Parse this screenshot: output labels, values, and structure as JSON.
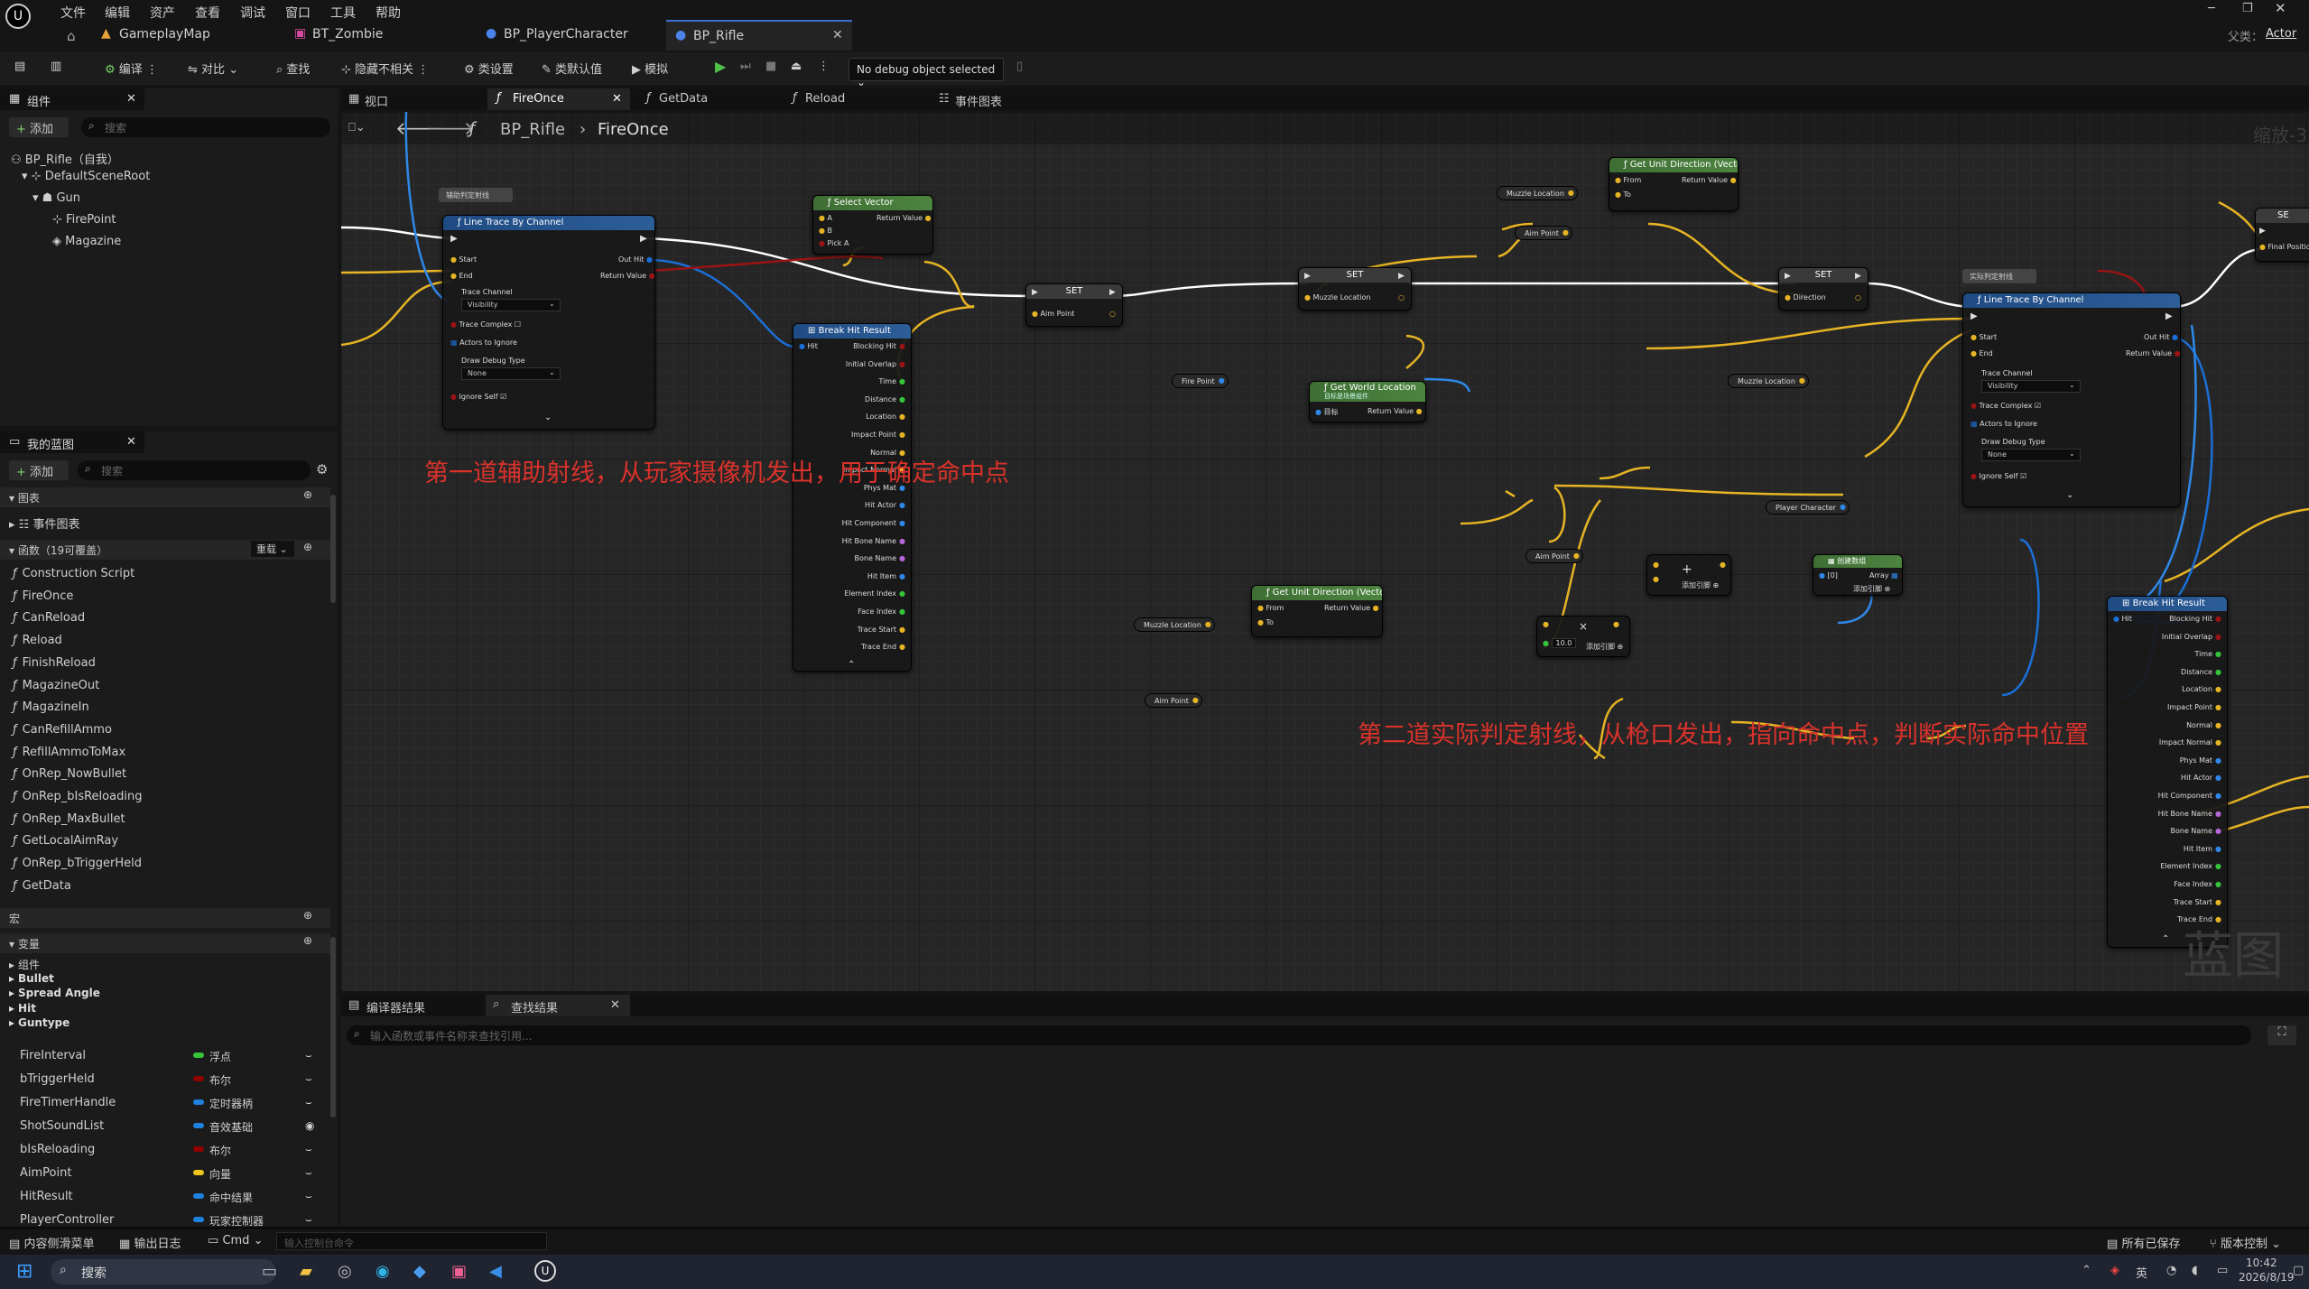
{
  "menu": [
    "文件",
    "编辑",
    "资产",
    "查看",
    "调试",
    "窗口",
    "工具",
    "帮助"
  ],
  "tabs": [
    "GameplayMap",
    "BT_Zombie",
    "BP_PlayerCharacter",
    "BP_Rifle"
  ],
  "parent_label": "父类：",
  "parent_value": "Actor",
  "toolbar": {
    "compile": "编译",
    "diff": "对比",
    "find": "查找",
    "hide_unrelated": "隐藏不相关",
    "class_settings": "类设置",
    "class_defaults": "类默认值",
    "simulate": "模拟",
    "debug_select": "No debug object selected"
  },
  "components_panel": {
    "title": "组件",
    "add": "添加",
    "search_placeholder": "搜索",
    "items": [
      "BP_Rifle（自我）",
      "DefaultSceneRoot",
      "Gun",
      "FirePoint",
      "Magazine"
    ]
  },
  "graph_tabs": [
    "视口",
    "FireOnce",
    "GetData",
    "Reload",
    "事件图表"
  ],
  "breadcrumb": {
    "root": "BP_Rifle",
    "current": "FireOnce"
  },
  "zoom": "缩放-3",
  "watermark": "蓝图",
  "my_blueprint": {
    "title": "我的蓝图",
    "add": "添加",
    "search_placeholder": "搜索",
    "graphs_header": "图表",
    "event_graph": "事件图表",
    "functions_header": "函数（19可覆盖）",
    "override_label": "重载",
    "functions": [
      "Construction Script",
      "FireOnce",
      "CanReload",
      "Reload",
      "FinishReload",
      "MagazineOut",
      "MagazineIn",
      "CanRefillAmmo",
      "RefillAmmoToMax",
      "OnRep_NowBullet",
      "OnRep_bIsReloading",
      "OnRep_MaxBullet",
      "GetLocalAimRay",
      "OnRep_bTriggerHeld",
      "GetData"
    ],
    "macros_header": "宏",
    "variables_header": "变量",
    "var_groups": [
      "组件",
      "Bullet",
      "Spread Angle",
      "Hit",
      "Guntype"
    ],
    "variables": [
      {
        "name": "FireInterval",
        "type": "浮点",
        "color": "#35c43a"
      },
      {
        "name": "bTriggerHeld",
        "type": "布尔",
        "color": "#920000"
      },
      {
        "name": "FireTimerHandle",
        "type": "定时器柄",
        "color": "#1f82e0"
      },
      {
        "name": "ShotSoundList",
        "type": "音效基础",
        "color": "#1f82e0"
      },
      {
        "name": "bIsReloading",
        "type": "布尔",
        "color": "#920000"
      },
      {
        "name": "AimPoint",
        "type": "向量",
        "color": "#f0c419"
      },
      {
        "name": "HitResult",
        "type": "命中结果",
        "color": "#1f82e0"
      },
      {
        "name": "PlayerController",
        "type": "玩家控制器",
        "color": "#1f82e0"
      }
    ]
  },
  "annotations": {
    "first": "第一道辅助射线，从玩家摄像机发出，用于确定命中点",
    "second": "第二道实际判定射线，从枪口发出，指向命中点，判断实际命中位置"
  },
  "nodes": {
    "lt1": {
      "comment": "辅助判定射线",
      "title": "Line Trace By Channel",
      "pins_l": [
        "Start",
        "End"
      ],
      "pins_r": [
        "Out Hit",
        "Return Value"
      ],
      "channel_label": "Trace Channel",
      "channel_value": "Visibility",
      "complex": "Trace Complex",
      "actors": "Actors to Ignore",
      "debug_label": "Draw Debug Type",
      "debug_value": "None",
      "ignore_self": "Ignore Self"
    },
    "select": {
      "title": "Select Vector",
      "pins_l": [
        "A",
        "B",
        "Pick A"
      ],
      "pins_r": [
        "Return Value"
      ]
    },
    "bhr1": {
      "title": "Break Hit Result",
      "pin_l": "Hit",
      "pins_r": [
        "Blocking Hit",
        "Initial Overlap",
        "Time",
        "Distance",
        "Location",
        "Impact Point",
        "Normal",
        "Impact Normal",
        "Phys Mat",
        "Hit Actor",
        "Hit Component",
        "Hit Bone Name",
        "Bone Name",
        "Hit Item",
        "Element Index",
        "Face Index",
        "Trace Start",
        "Trace End"
      ]
    },
    "set1": {
      "title": "SET",
      "pin": "Aim Point"
    },
    "set2": {
      "title": "SET",
      "pin": "Muzzle Location"
    },
    "set3": {
      "title": "SET",
      "pin": "Direction"
    },
    "gud1": {
      "title": "Get Unit Direction (Vector)",
      "pins_l": [
        "From",
        "To"
      ],
      "pins_r": [
        "Return Value"
      ]
    },
    "gwl": {
      "title": "Get World Location",
      "subtitle": "目标是场景组件",
      "pin_l": "目标",
      "pin_r": "Return Value"
    },
    "lt2": {
      "comment": "实际判定射线",
      "title": "Line Trace By Channel",
      "pins_l": [
        "Start",
        "End"
      ],
      "pins_r": [
        "Out Hit",
        "Return Value"
      ],
      "channel_label": "Trace Channel",
      "channel_value": "Visibility",
      "complex": "Trace Complex",
      "actors": "Actors to Ignore",
      "debug_label": "Draw Debug Type",
      "debug_value": "None",
      "ignore_self": "Ignore Self"
    },
    "gud2": {
      "title": "Get Unit Direction (Vector)",
      "pins_l": [
        "From",
        "To"
      ],
      "pins_r": [
        "Return Value"
      ]
    },
    "make_array": {
      "title": "创建数组",
      "pin_l": "[0]",
      "pin_r": "Array",
      "add_pin": "添加引脚"
    },
    "add1": {
      "add_pin": "添加引脚"
    },
    "mult": {
      "value": "10.0",
      "add_pin": "添加引脚"
    },
    "bhr2": {
      "title": "Break Hit Result",
      "pin_l": "Hit",
      "pins_r": [
        "Blocking Hit",
        "Initial Overlap",
        "Time",
        "Distance",
        "Location",
        "Impact Point",
        "Normal",
        "Impact Normal",
        "Phys Mat",
        "Hit Actor",
        "Hit Component",
        "Hit Bone Name",
        "Bone Name",
        "Hit Item",
        "Element Index",
        "Face Index",
        "Trace Start",
        "Trace End"
      ]
    },
    "edge": {
      "title": "SE",
      "pin": "Final Position"
    }
  },
  "var_pills": {
    "fire_point": "Fire Point",
    "muzzle1": "Muzzle Location",
    "aim1": "Aim Point",
    "muzzle2": "Muzzle Location",
    "player": "Player Character",
    "aim2": "Aim Point",
    "muzzle3": "Muzzle Location",
    "aim3": "Aim Point"
  },
  "bottom_tabs": {
    "compiler": "编译器结果",
    "find": "查找结果",
    "find_placeholder": "输入函数或事件名称来查找引用..."
  },
  "statusbar": {
    "content_drawer": "内容侧滑菜单",
    "output_log": "输出日志",
    "cmd": "Cmd",
    "cmd_placeholder": "输入控制台命令",
    "saved": "所有已保存",
    "version": "版本控制"
  },
  "taskbar": {
    "search": "搜索",
    "time": "10:42",
    "date": "2026/8/19",
    "ime": "英"
  }
}
